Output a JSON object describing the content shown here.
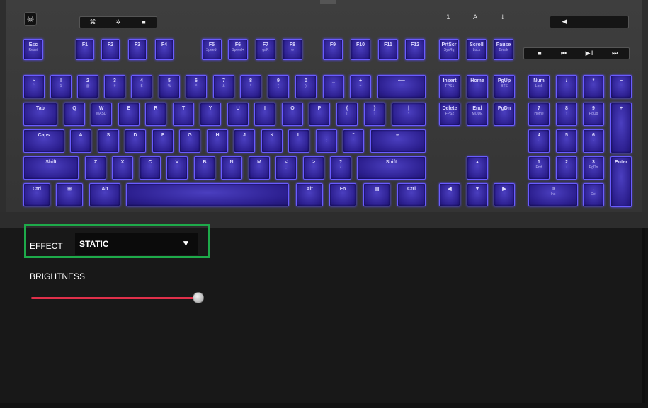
{
  "effect": {
    "label": "EFFECT",
    "value": "STATIC",
    "arrow": "▼"
  },
  "brightness": {
    "label": "BRIGHTNESS",
    "level_percent": 100
  },
  "colors": {
    "key_glow": "#4b3fc0",
    "key_border": "#6a5cff",
    "slider": "#e0304a",
    "highlight_box": "#1eaa4a"
  },
  "top_bar": {
    "left_icons": [
      "controller-icon",
      "sun-icon",
      "lock-icon"
    ],
    "media_icons": [
      "stop-icon",
      "prev-icon",
      "play-pause-icon",
      "next-icon"
    ],
    "mute_icon": "mute-icon"
  },
  "keys": {
    "esc": [
      "Esc",
      "Reset"
    ],
    "f1": [
      "F1",
      ""
    ],
    "f2": [
      "F2",
      ""
    ],
    "f3": [
      "F3",
      ""
    ],
    "f4": [
      "F4",
      ""
    ],
    "f5": [
      "F5",
      "Speed-"
    ],
    "f6": [
      "F6",
      "Speed+"
    ],
    "f7": [
      "F7",
      "gaR"
    ],
    "f8": [
      "F8",
      "∞"
    ],
    "f9": [
      "F9",
      ""
    ],
    "f10": [
      "F10",
      ""
    ],
    "f11": [
      "F11",
      ""
    ],
    "f12": [
      "F12",
      ""
    ],
    "prtscr": [
      "PrtScr",
      "SysRq"
    ],
    "scrlk": [
      "Scroll",
      "Lock"
    ],
    "pause": [
      "Pause",
      "Break"
    ],
    "tilde": [
      "~",
      "`"
    ],
    "n1": [
      "!",
      "1"
    ],
    "n2": [
      "2",
      "@"
    ],
    "n3": [
      "3",
      "#"
    ],
    "n4": [
      "4",
      "$"
    ],
    "n5": [
      "5",
      "%"
    ],
    "n6": [
      "6",
      "^"
    ],
    "n7": [
      "7",
      "&"
    ],
    "n8": [
      "8",
      "*"
    ],
    "n9": [
      "9",
      "("
    ],
    "n0": [
      "0",
      ")"
    ],
    "minus": [
      "_",
      "-"
    ],
    "equal": [
      "+",
      "="
    ],
    "backspace": [
      "⟵",
      ""
    ],
    "insert": [
      "Insert",
      "FPS1"
    ],
    "home": [
      "Home",
      ""
    ],
    "pgup": [
      "PgUp",
      "BTS"
    ],
    "numlock": [
      "Num",
      "Lock"
    ],
    "kp_div": [
      "/",
      ""
    ],
    "kp_mul": [
      "*",
      ""
    ],
    "kp_minus": [
      "−",
      ""
    ],
    "tab": [
      "Tab",
      ""
    ],
    "q": [
      "Q",
      ""
    ],
    "w": [
      "W",
      "WASD"
    ],
    "e": [
      "E",
      ""
    ],
    "r": [
      "R",
      ""
    ],
    "t": [
      "T",
      ""
    ],
    "y": [
      "Y",
      ""
    ],
    "u": [
      "U",
      ""
    ],
    "i": [
      "I",
      ""
    ],
    "o": [
      "O",
      ""
    ],
    "p": [
      "P",
      ""
    ],
    "lbr": [
      "{",
      "["
    ],
    "rbr": [
      "}",
      "]"
    ],
    "bslash": [
      "|",
      "\\"
    ],
    "delete": [
      "Delete",
      "FPS2"
    ],
    "end": [
      "End",
      "MODE"
    ],
    "pgdn": [
      "PgDn",
      ""
    ],
    "kp7": [
      "7",
      "Home"
    ],
    "kp8": [
      "8",
      "↑"
    ],
    "kp9": [
      "9",
      "PgUp"
    ],
    "kp_plus": [
      "+",
      ""
    ],
    "caps": [
      "Caps",
      ""
    ],
    "a": [
      "A",
      ""
    ],
    "s": [
      "S",
      ""
    ],
    "d": [
      "D",
      ""
    ],
    "f": [
      "F",
      ""
    ],
    "g": [
      "G",
      ""
    ],
    "h": [
      "H",
      ""
    ],
    "j": [
      "J",
      ""
    ],
    "k": [
      "K",
      ""
    ],
    "l": [
      "L",
      ""
    ],
    "semi": [
      ":",
      ";"
    ],
    "quote": [
      "\"",
      "'"
    ],
    "enter": [
      "↵",
      ""
    ],
    "kp4": [
      "4",
      "←"
    ],
    "kp5": [
      "5",
      ""
    ],
    "kp6": [
      "6",
      "→"
    ],
    "lshift": [
      "Shift",
      ""
    ],
    "z": [
      "Z",
      ""
    ],
    "x": [
      "X",
      ""
    ],
    "c": [
      "C",
      ""
    ],
    "v": [
      "V",
      ""
    ],
    "b": [
      "B",
      ""
    ],
    "n": [
      "N",
      ""
    ],
    "m": [
      "M",
      ""
    ],
    "comma": [
      "<",
      ","
    ],
    "period": [
      ">",
      "."
    ],
    "slash": [
      "?",
      "/"
    ],
    "rshift": [
      "Shift",
      ""
    ],
    "up": [
      "▲",
      ""
    ],
    "kp1": [
      "1",
      "End"
    ],
    "kp2": [
      "2",
      "↓"
    ],
    "kp3": [
      "3",
      "PgDn"
    ],
    "kp_enter": [
      "Enter",
      ""
    ],
    "lctrl": [
      "Ctrl",
      ""
    ],
    "lwin": [
      "⊞",
      ""
    ],
    "lalt": [
      "Alt",
      ""
    ],
    "space": [
      "",
      ""
    ],
    "ralt": [
      "Alt",
      ""
    ],
    "fn": [
      "Fn",
      ""
    ],
    "menu": [
      "▤",
      ""
    ],
    "rctrl": [
      "Ctrl",
      ""
    ],
    "left": [
      "◀",
      ""
    ],
    "down": [
      "▼",
      ""
    ],
    "right": [
      "▶",
      ""
    ],
    "kp0": [
      "0",
      "Ins"
    ],
    "kp_dot": [
      ".",
      "Del"
    ]
  }
}
